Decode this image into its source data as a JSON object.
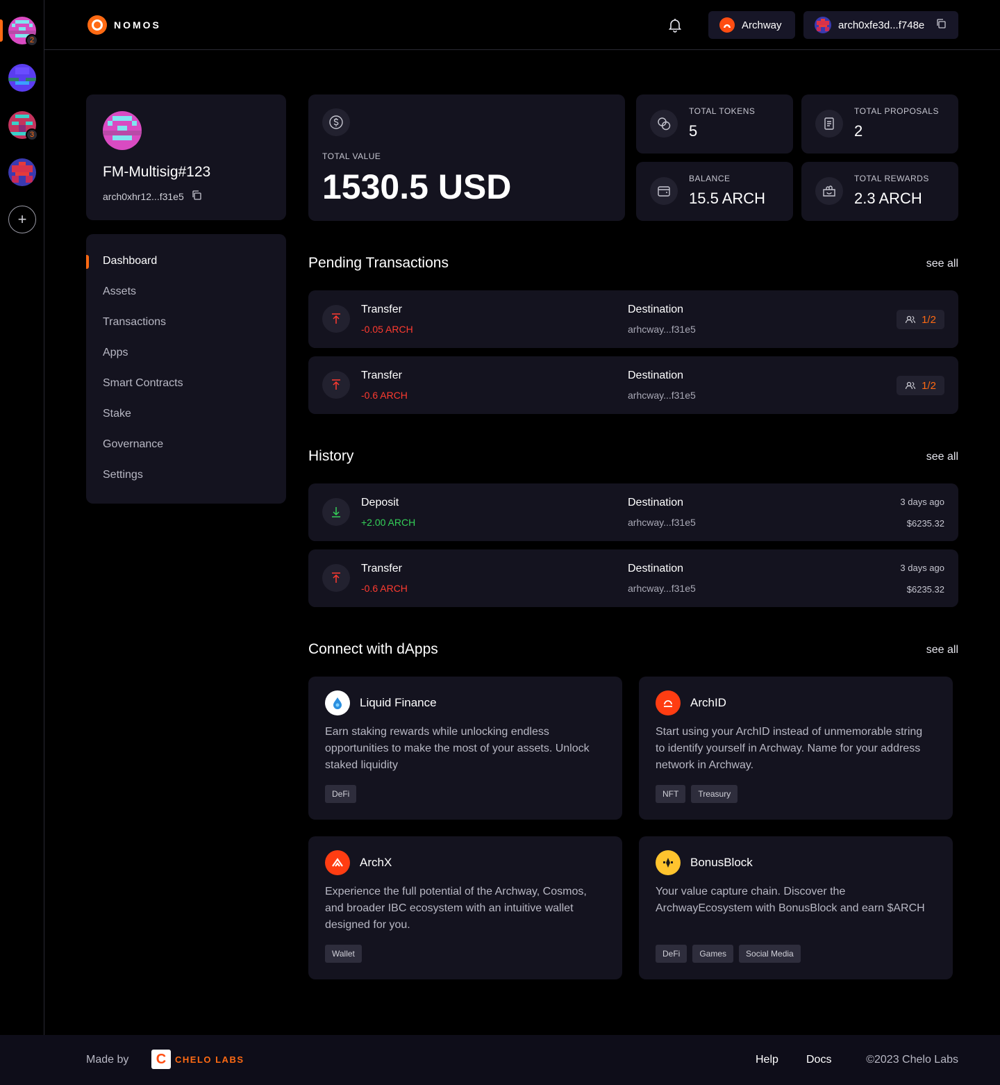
{
  "brand": {
    "name": "NOMOS",
    "accent": "#ff6a13"
  },
  "rail": {
    "wallets": [
      {
        "count": "2"
      },
      {
        "count": ""
      },
      {
        "count": "3"
      },
      {
        "count": ""
      }
    ],
    "add_symbol": "+"
  },
  "header": {
    "network_label": "Archway",
    "address_label": "arch0xfe3d...f748e"
  },
  "profile": {
    "name": "FM-Multisig#123",
    "address": "arch0xhr12...f31e5"
  },
  "nav": {
    "items": [
      {
        "label": "Dashboard"
      },
      {
        "label": "Assets"
      },
      {
        "label": "Transactions"
      },
      {
        "label": "Apps"
      },
      {
        "label": "Smart Contracts"
      },
      {
        "label": "Stake"
      },
      {
        "label": "Governance"
      },
      {
        "label": "Settings"
      }
    ]
  },
  "stats": {
    "total_value": {
      "label": "TOTAL VALUE",
      "value": "1530.5 USD"
    },
    "tokens": {
      "label": "TOTAL TOKENS",
      "value": "5"
    },
    "proposals": {
      "label": "TOTAL PROPOSALS",
      "value": "2"
    },
    "balance": {
      "label": "BALANCE",
      "value": "15.5 ARCH"
    },
    "rewards": {
      "label": "TOTAL REWARDS",
      "value": "2.3 ARCH"
    }
  },
  "pending": {
    "title": "Pending Transactions",
    "see_all": "see all",
    "items": [
      {
        "type": "Transfer",
        "amount": "-0.05 ARCH",
        "dest_label": "Destination",
        "dest": "arhcway...f31e5",
        "sigs": "1/2"
      },
      {
        "type": "Transfer",
        "amount": "-0.6 ARCH",
        "dest_label": "Destination",
        "dest": "arhcway...f31e5",
        "sigs": "1/2"
      }
    ]
  },
  "history": {
    "title": "History",
    "see_all": "see all",
    "items": [
      {
        "type": "Deposit",
        "amount": "+2.00 ARCH",
        "dest_label": "Destination",
        "dest": "arhcway...f31e5",
        "time": "3 days ago",
        "usd": "$6235.32"
      },
      {
        "type": "Transfer",
        "amount": "-0.6 ARCH",
        "dest_label": "Destination",
        "dest": "arhcway...f31e5",
        "time": "3 days ago",
        "usd": "$6235.32"
      }
    ]
  },
  "dapps": {
    "title": "Connect with dApps",
    "see_all": "see all",
    "items": [
      {
        "name": "Liquid Finance",
        "desc": "Earn staking rewards while unlocking endless opportunities to make the most of your assets. Unlock staked liquidity",
        "tags": [
          "DeFi"
        ]
      },
      {
        "name": "ArchID",
        "desc": "Start using your ArchID instead of unmemorable string to identify yourself in Archway. Name for your address network in Archway.",
        "tags": [
          "NFT",
          "Treasury"
        ]
      },
      {
        "name": "ArchX",
        "desc": "Experience the full potential of the Archway, Cosmos, and broader IBC ecosystem with an intuitive wallet designed for you.",
        "tags": [
          "Wallet"
        ]
      },
      {
        "name": "BonusBlock",
        "desc": "Your value capture chain. Discover the ArchwayEcosystem with BonusBlock and earn $ARCH",
        "tags": [
          "DeFi",
          "Games",
          "Social Media"
        ]
      }
    ]
  },
  "footer": {
    "made_by": "Made by",
    "company": "CHELO LABS",
    "company_mark": "C",
    "help": "Help",
    "docs": "Docs",
    "copyright": "©2023 Chelo Labs"
  }
}
